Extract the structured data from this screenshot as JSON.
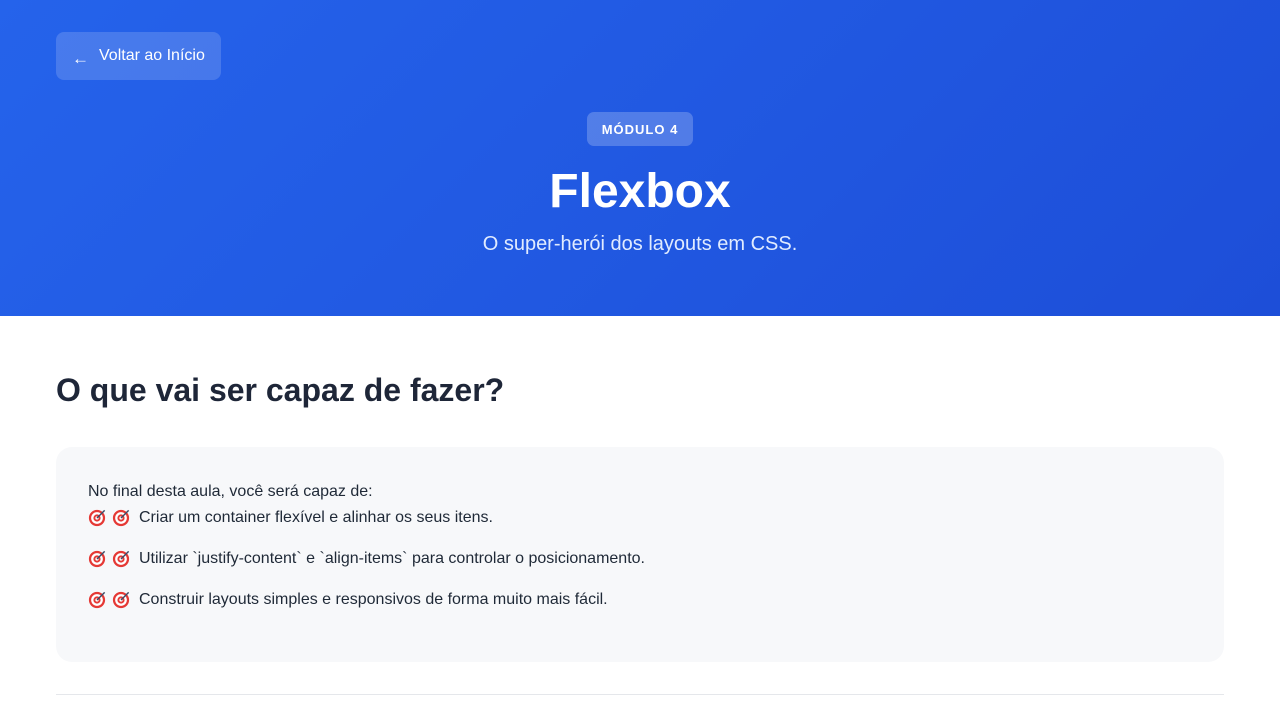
{
  "colors": {
    "hero_gradient_start": "#2563eb",
    "hero_gradient_end": "#1d4ed8",
    "card_background": "#f7f8fa",
    "heading_text": "#1e2638",
    "target_red": "#e53935"
  },
  "header": {
    "back_arrow": "←",
    "back_label": "Voltar ao Início",
    "module_badge": "MÓDULO 4",
    "title": "Flexbox",
    "subtitle": "O super-herói dos layouts em CSS."
  },
  "main": {
    "section_heading": "O que vai ser capaz de fazer?",
    "card": {
      "intro": "No final desta aula, você será capaz de:",
      "icon": "target-icon",
      "objectives": [
        "Criar um container flexível e alinhar os seus itens.",
        "Utilizar `justify-content` e `align-items` para controlar o posicionamento.",
        "Construir layouts simples e responsivos de forma muito mais fácil."
      ]
    }
  }
}
